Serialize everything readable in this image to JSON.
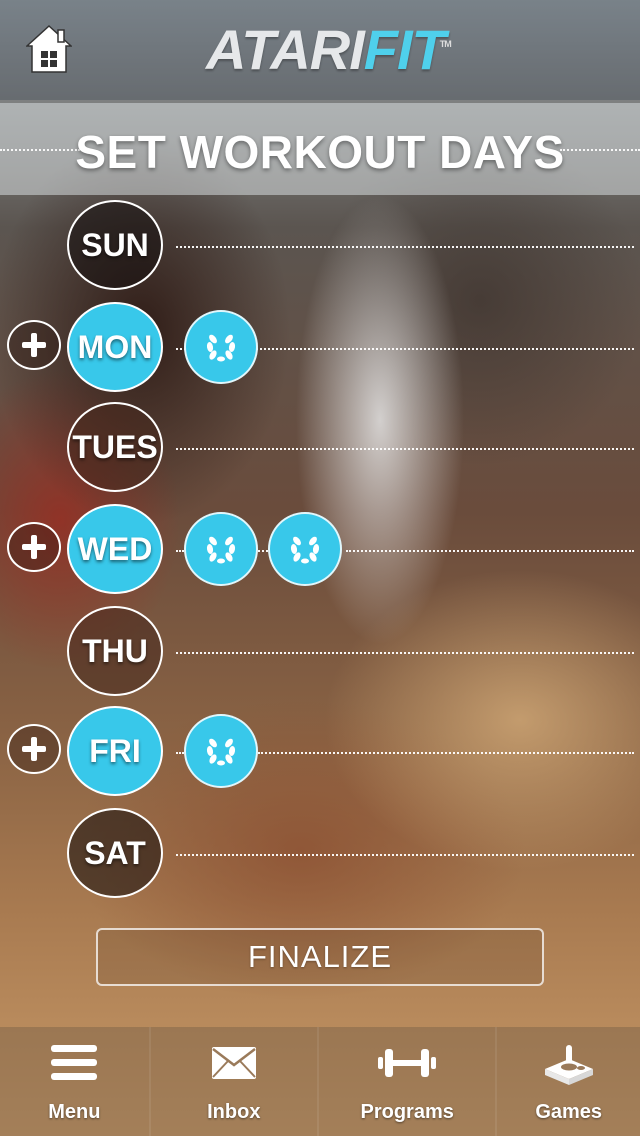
{
  "header": {
    "logo_part1": "ATARI",
    "logo_part2": "FIT",
    "logo_tm": "TM",
    "home_icon": "home-icon"
  },
  "page": {
    "title": "SET WORKOUT DAYS"
  },
  "days": [
    {
      "label": "SUN",
      "active": false,
      "workouts": 0
    },
    {
      "label": "MON",
      "active": true,
      "workouts": 1
    },
    {
      "label": "TUES",
      "active": false,
      "workouts": 0
    },
    {
      "label": "WED",
      "active": true,
      "workouts": 2
    },
    {
      "label": "THU",
      "active": false,
      "workouts": 0
    },
    {
      "label": "FRI",
      "active": true,
      "workouts": 1
    },
    {
      "label": "SAT",
      "active": false,
      "workouts": 0
    }
  ],
  "actions": {
    "finalize_label": "FINALIZE"
  },
  "tabbar": {
    "items": [
      {
        "label": "Menu",
        "icon": "menu-icon"
      },
      {
        "label": "Inbox",
        "icon": "envelope-icon"
      },
      {
        "label": "Programs",
        "icon": "dumbbell-icon"
      },
      {
        "label": "Games",
        "icon": "joystick-icon"
      }
    ]
  },
  "colors": {
    "accent": "#38c8ea",
    "logo_accent": "#4fd0ec"
  }
}
